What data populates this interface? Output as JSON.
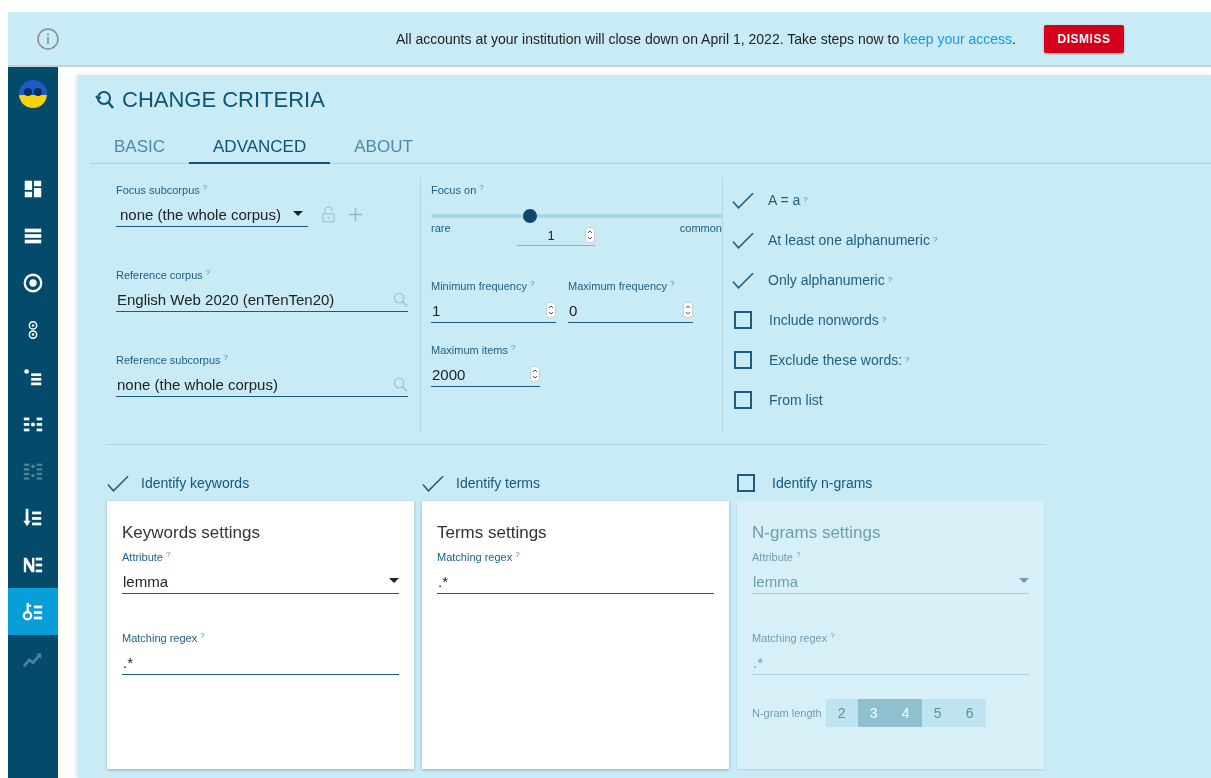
{
  "banner": {
    "message": "All accounts at your institution will close down on April 1, 2022. Take steps now to",
    "link": "keep your access",
    "after": ".",
    "button": "DISMISS"
  },
  "sidebar": {
    "items": [
      {
        "kind": "dashboard",
        "selected": false,
        "disabled": false
      },
      {
        "kind": "list",
        "selected": false,
        "disabled": false
      },
      {
        "kind": "target",
        "selected": false,
        "disabled": false
      },
      {
        "kind": "circles",
        "selected": false,
        "disabled": false
      },
      {
        "kind": "bullets",
        "selected": false,
        "disabled": false
      },
      {
        "kind": "dotted",
        "selected": false,
        "disabled": false
      },
      {
        "kind": "grid",
        "selected": false,
        "disabled": true
      },
      {
        "kind": "sort",
        "selected": false,
        "disabled": false
      },
      {
        "kind": "nlist",
        "selected": false,
        "disabled": false
      },
      {
        "kind": "keylist",
        "selected": true,
        "disabled": false
      },
      {
        "kind": "trend",
        "selected": false,
        "disabled": true
      }
    ]
  },
  "title": "CHANGE CRITERIA",
  "tabs": [
    {
      "label": "BASIC",
      "selected": false
    },
    {
      "label": "ADVANCED",
      "selected": true
    },
    {
      "label": "ABOUT",
      "selected": false
    }
  ],
  "corpus_fields": [
    {
      "kind": "subcorpus",
      "label": "Focus subcorpus",
      "help": "?",
      "value": "none (the whole corpus)"
    },
    {
      "kind": "search",
      "label": "Reference corpus",
      "help": "?",
      "value": "English Web 2020 (enTenTen20)"
    },
    {
      "kind": "search",
      "label": "Reference subcorpus",
      "help": "?",
      "value": "none (the whole corpus)"
    }
  ],
  "focus": {
    "label": "Focus on",
    "help": "?",
    "level": 0.34,
    "min_label": "rare",
    "max_label": "common",
    "value": "1"
  },
  "frequency_fields": [
    {
      "kind": "spin",
      "label": "Minimum frequency",
      "help": "?",
      "value": "1"
    },
    {
      "kind": "spin",
      "label": "Maximum frequency",
      "help": "?",
      "value": "0"
    },
    {
      "kind": "spin",
      "label": "Maximum items",
      "help": "?",
      "value": "2000"
    }
  ],
  "options": [
    {
      "label": "A = a",
      "help": "?",
      "checked": true
    },
    {
      "label": "At least one alphanumeric",
      "help": "?",
      "checked": true
    },
    {
      "label": "Only alphanumeric",
      "help": "?",
      "checked": true
    },
    {
      "label": "Include nonwords",
      "help": "?",
      "checked": false
    },
    {
      "label": "Exclude these words:",
      "help": "?",
      "checked": false
    },
    {
      "label": "From list",
      "checked": false
    }
  ],
  "sections": [
    {
      "label": "Identify keywords",
      "checked": true,
      "card": {
        "title": "Keywords settings",
        "fields": [
          {
            "kind": "select",
            "label": "Attribute",
            "help": "?",
            "value": "lemma"
          },
          {
            "kind": "text",
            "label": "Matching regex",
            "help": "?",
            "value": ".*"
          }
        ]
      }
    },
    {
      "label": "Identify terms",
      "checked": true,
      "card": {
        "title": "Terms settings",
        "fields": [
          {
            "kind": "text",
            "label": "Matching regex",
            "help": "?",
            "value": ".*"
          }
        ]
      }
    },
    {
      "label": "Identify n-grams",
      "checked": false,
      "card": {
        "title": "N-grams settings",
        "fields": [
          {
            "kind": "select",
            "label": "Attribute",
            "help": "?",
            "value": "lemma"
          },
          {
            "kind": "text",
            "label": "Matching regex",
            "help": "?",
            "value": ".*"
          }
        ],
        "ngram_length": {
          "label": "N-gram length",
          "options": [
            {
              "label": "2",
              "selected": false
            },
            {
              "label": "3",
              "selected": true
            },
            {
              "label": "4",
              "selected": true
            },
            {
              "label": "5",
              "selected": false
            },
            {
              "label": "6",
              "selected": false
            }
          ]
        }
      }
    }
  ]
}
